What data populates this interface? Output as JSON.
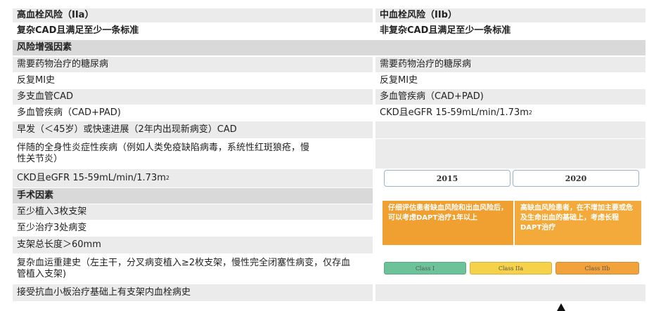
{
  "header": {
    "left_title": "高血栓风险（IIa）",
    "right_title": "中血栓风险（IIb）"
  },
  "criteria": {
    "left": "复杂CAD且满足至少一条标准",
    "right": "非复杂CAD且满足至少一条标准"
  },
  "section_risk": "风险增强因素",
  "risk_left": [
    "需要药物治疗的糖尿病",
    "反复MI史",
    "多支血管CAD",
    "多血管疾病（CAD+PAD)",
    "早发（＜45岁）或快速进展（2年内出现新病变）CAD",
    "伴随的全身性炎症性疾病（例如人类免疫缺陷病毒，系统性红斑狼疮，慢性关节炎）"
  ],
  "risk_left_last": {
    "text": "CKD且eGFR 15-59mL/min/1.73m",
    "sup": "2"
  },
  "risk_right": [
    "需要药物治疗的糖尿病",
    "反复MI史",
    "多血管疾病（CAD+PAD)"
  ],
  "risk_right_last": {
    "text": "CKD且eGFR 15-59mL/min/1.73m",
    "sup": "2"
  },
  "section_proc": "手术因素",
  "proc_left": [
    "至少植入3枚支架",
    "至少治疗3处病变",
    "支架总长度＞60mm",
    "复杂血运重建史（左主干，分叉病变植入≥2枚支架，慢性完全闭塞性病变，仅存血管植入支架)",
    "接受抗血小板治疗基础上有支架内血栓病史"
  ],
  "timeline": {
    "year_2015": "2015",
    "year_2020": "2020",
    "box_2015": "仔细评估患者缺血风险和出血风险后，可以考虑DAPT治疗1年以上",
    "box_2020": "高缺血风险患者，在不增加主要或危及生命出血的基础上，考虑长程DAPT治疗",
    "class_1": "Class I",
    "class_2a": "Class IIa",
    "class_2b": "Class IIb"
  },
  "colors": {
    "orange": "#f0a030",
    "green": "#6cc39a",
    "yellow": "#f6d24a",
    "orange_pill": "#f2a23a"
  }
}
